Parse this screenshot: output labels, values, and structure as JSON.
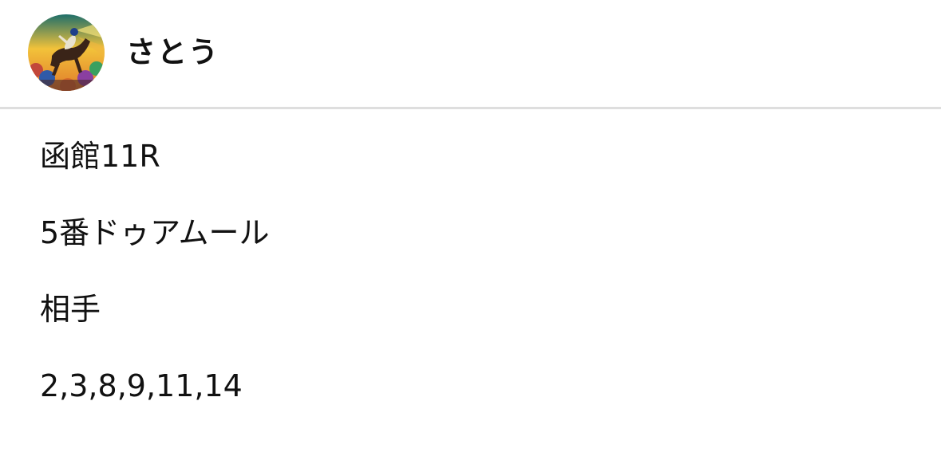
{
  "user": {
    "name": "さとう",
    "avatar_icon": "jockey-horse-racing-avatar-icon"
  },
  "post": {
    "lines": [
      "函館11R",
      "5番ドゥアムール",
      "相手",
      "2,3,8,9,11,14"
    ]
  },
  "colors": {
    "divider": "#dedede",
    "text": "#111111",
    "background": "#ffffff"
  }
}
